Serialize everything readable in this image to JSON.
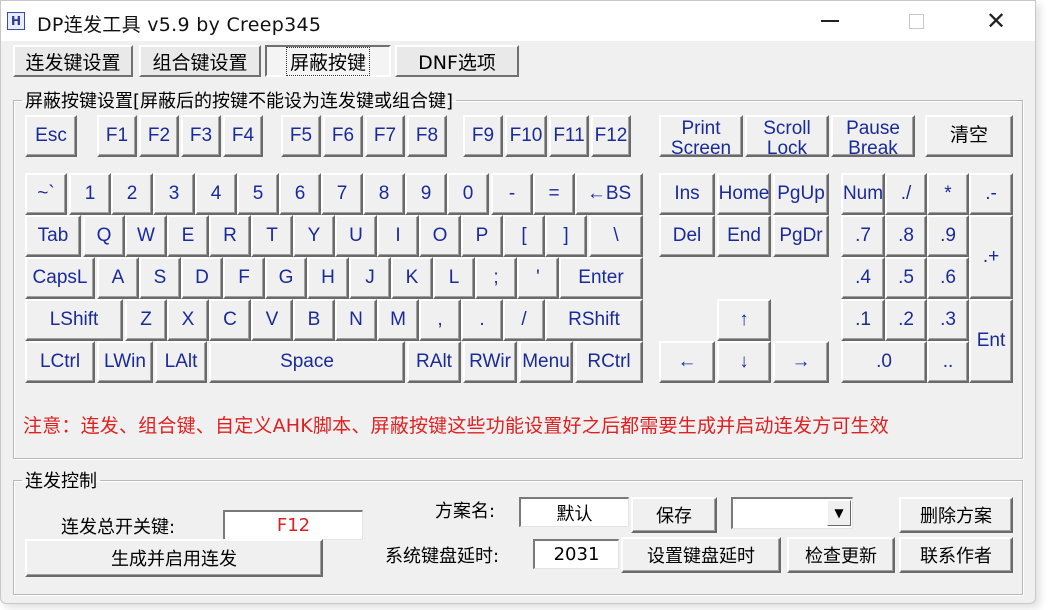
{
  "window": {
    "title": "DP连发工具 v5.9 by Creep345",
    "icon_letter": "H",
    "controls": {
      "minimize_icon": "minimize-icon",
      "maximize_icon": "maximize-icon",
      "close_icon": "close-icon",
      "close_glyph": "✕"
    }
  },
  "tabs": [
    "连发键设置",
    "组合键设置",
    "屏蔽按键",
    "DNF选项"
  ],
  "block_section": {
    "legend": "屏蔽按键设置[屏蔽后的按键不能设为连发键或组合键]",
    "function_row": [
      "Esc",
      "F1",
      "F2",
      "F3",
      "F4",
      "F5",
      "F6",
      "F7",
      "F8",
      "F9",
      "F10",
      "F11",
      "F12"
    ],
    "special_keys": {
      "print_screen": "Print Screen",
      "scroll_lock": "Scroll Lock",
      "pause_break": "Pause Break",
      "clear": "清空"
    },
    "number_row": [
      "~`",
      "1",
      "2",
      "3",
      "4",
      "5",
      "6",
      "7",
      "8",
      "9",
      "0",
      "-",
      "=",
      "←BS"
    ],
    "q_row": [
      "Tab",
      "Q",
      "W",
      "E",
      "R",
      "T",
      "Y",
      "U",
      "I",
      "O",
      "P",
      "[",
      "]",
      "\\"
    ],
    "a_row": [
      "CapsL",
      "A",
      "S",
      "D",
      "F",
      "G",
      "H",
      "J",
      "K",
      "L",
      ";",
      "'",
      "Enter"
    ],
    "z_row": [
      "LShift",
      "Z",
      "X",
      "C",
      "V",
      "B",
      "N",
      "M",
      ",",
      ".",
      "/",
      "RShift"
    ],
    "bottom_row": [
      "LCtrl",
      "LWin",
      "LAlt",
      "Space",
      "RAlt",
      "RWir",
      "Menu",
      "RCtrl"
    ],
    "nav_top": [
      "Ins",
      "Home",
      "PgUp"
    ],
    "nav_bottom": [
      "Del",
      "End",
      "PgDr"
    ],
    "arrows": {
      "up": "↑",
      "left": "←",
      "down": "↓",
      "right": "→"
    },
    "numpad": {
      "num": "Num",
      "div": "./",
      "mul": "*",
      "sub": ".-",
      "n7": ".7",
      "n8": ".8",
      "n9": ".9",
      "add": ".+",
      "n4": ".4",
      "n5": ".5",
      "n6": ".6",
      "n1": ".1",
      "n2": ".2",
      "n3": ".3",
      "enter": "Ent",
      "n0": ".0",
      "dot": ".."
    },
    "warning": "注意：连发、组合键、自定义AHK脚本、屏蔽按键这些功能设置好之后都需要生成并启动连发方可生效"
  },
  "control_section": {
    "legend": "连发控制",
    "master_key_label": "连发总开关键:",
    "master_key_value": "F12",
    "generate_button": "生成并启用连发",
    "scheme_label": "方案名:",
    "scheme_value": "默认",
    "save_button": "保存",
    "scheme_select_value": "",
    "select_arrow": "▼",
    "delete_button": "删除方案",
    "delay_label": "系统键盘延时:",
    "delay_value": "2031",
    "set_delay_button": "设置键盘延时",
    "check_update_button": "检查更新",
    "contact_button": "联系作者"
  },
  "colors": {
    "key_text": "#1a2a9a",
    "warning": "#e02020",
    "master_key": "#e02020",
    "window_bg": "#f0f0f0"
  }
}
